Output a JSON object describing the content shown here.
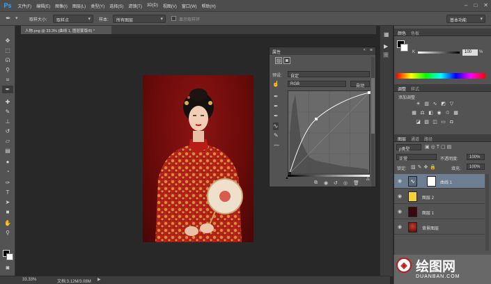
{
  "app": {
    "logo": "Ps"
  },
  "menubar": {
    "items": [
      "文件(F)",
      "编辑(E)",
      "图像(I)",
      "图层(L)",
      "类型(Y)",
      "选择(S)",
      "滤镜(T)",
      "3D(D)",
      "视图(V)",
      "窗口(W)",
      "帮助(H)"
    ],
    "window_controls": [
      "–",
      "□",
      "✕"
    ]
  },
  "options": {
    "sample_size_label": "取样大小:",
    "sample_size_value": "取样点",
    "sample_label": "样本:",
    "sample_value": "所有图层",
    "show_ring_label": "显示取样环",
    "workspace_value": "基本功能"
  },
  "document": {
    "tab_label": "人物.png @ 33.3% (曲线 1, 图层蒙版/8) *",
    "zoom": "33.33%",
    "doc_info": "文档:3.12M/3.08M"
  },
  "properties": {
    "title": "属性",
    "preset_label": "预设:",
    "preset_value": "自定",
    "channel_value": "RGB",
    "auto_button": "自动"
  },
  "color_panel": {
    "tabs": [
      "颜色",
      "色板"
    ],
    "k_label": "K",
    "k_value": "100",
    "percent": "%"
  },
  "adjustments_panel": {
    "tabs": [
      "调整",
      "样式"
    ],
    "title": "添加调整"
  },
  "layers_panel": {
    "tabs": [
      "图层",
      "通道",
      "路径"
    ],
    "kind_label": "ρ类型",
    "blend_mode": "正常",
    "opacity_label": "不透明度:",
    "opacity_value": "100%",
    "lock_label": "锁定:",
    "fill_label": "填充:",
    "fill_value": "100%",
    "layers": [
      {
        "name": "曲线 1",
        "selected": true
      },
      {
        "name": "图层 2",
        "thumb_color": "#f2d43a"
      },
      {
        "name": "图层 1",
        "thumb_color": "#3a0a0a"
      },
      {
        "name": "背景图层",
        "thumb_color": "#6d0b0b"
      }
    ]
  },
  "watermark": {
    "brand": "绘图网",
    "site": "DUANBAN.COM"
  },
  "colors": {
    "accent": "#31a8ff",
    "panel": "#535353",
    "selected_layer": "#6e7e92",
    "photo_bg": "#6d0b0b"
  }
}
